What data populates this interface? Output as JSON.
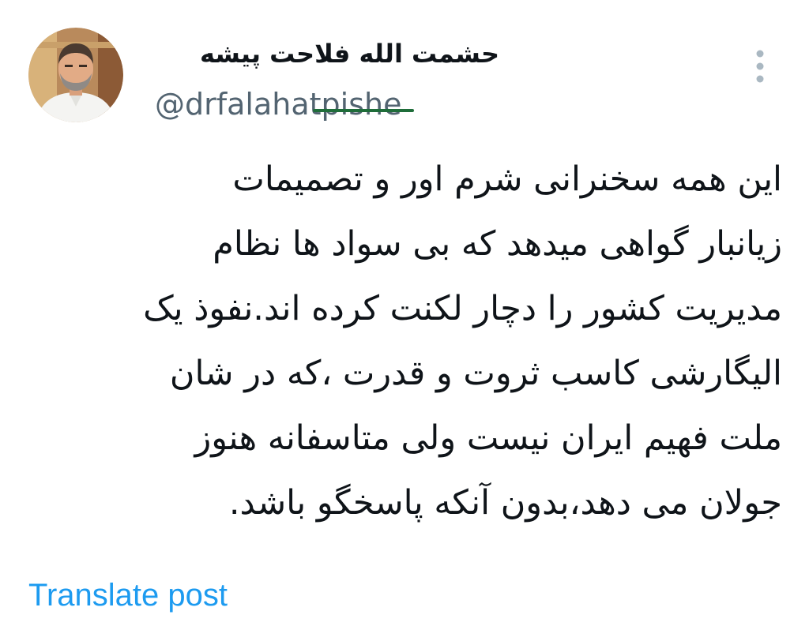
{
  "author": {
    "display_name": "حشمت الله فلاحت پیشه",
    "handle": "@drfalahatpishe"
  },
  "tweet": {
    "lines": [
      "این همه سخنرانی شرم اور و تصمیمات",
      "زیانبار گواهی میدهد که بی سواد ها نظام",
      "مدیریت کشور را دچار لکنت کرده اند.نفوذ یک",
      "الیگارشی کاسب ثروت و قدرت ،که در شان",
      "ملت فهیم ایران نیست ولی متاسفانه هنوز",
      "جولان می دهد،بدون آنکه پاسخگو باشد."
    ]
  },
  "actions": {
    "translate_label": "Translate post"
  },
  "icons": {
    "more": "more-vertical-icon",
    "avatar": "profile-photo"
  },
  "colors": {
    "link": "#1d9bf0",
    "secondary_text": "#536471",
    "primary_text": "#0f1419"
  }
}
